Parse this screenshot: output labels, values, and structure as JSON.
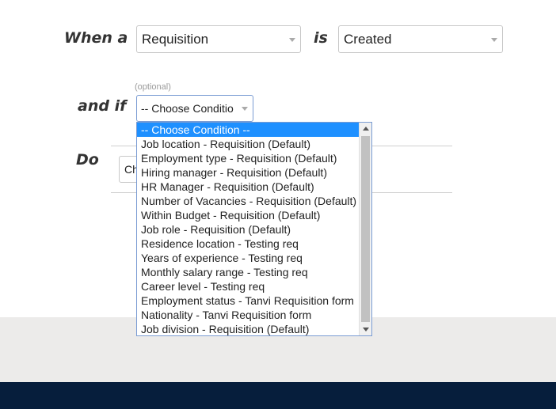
{
  "rule": {
    "when_label": "When a",
    "entity_value": "Requisition",
    "is_label": "is",
    "event_value": "Created",
    "and_if_label": "and if",
    "optional_hint": "(optional)",
    "condition_value": "-- Choose Conditio",
    "do_label": "Do",
    "action_value": "Ch"
  },
  "condition_dropdown": {
    "options": [
      "-- Choose Condition --",
      "Job location - Requisition (Default)",
      "Employment type - Requisition (Default)",
      "Hiring manager - Requisition (Default)",
      "HR Manager - Requisition (Default)",
      "Number of Vacancies - Requisition (Default)",
      "Within Budget - Requisition (Default)",
      "Job role - Requisition (Default)",
      "Residence location - Testing req",
      "Years of experience - Testing req",
      "Monthly salary range - Testing req",
      "Career level - Testing req",
      "Employment status - Tanvi Requisition form",
      "Nationality - Tanvi Requisition form",
      "Job division - Requisition (Default)"
    ],
    "selected_index": 0
  },
  "colors": {
    "selected_option_bg": "#1e90ff",
    "footer_bg": "#061e3c",
    "band_bg": "#ecebea"
  }
}
